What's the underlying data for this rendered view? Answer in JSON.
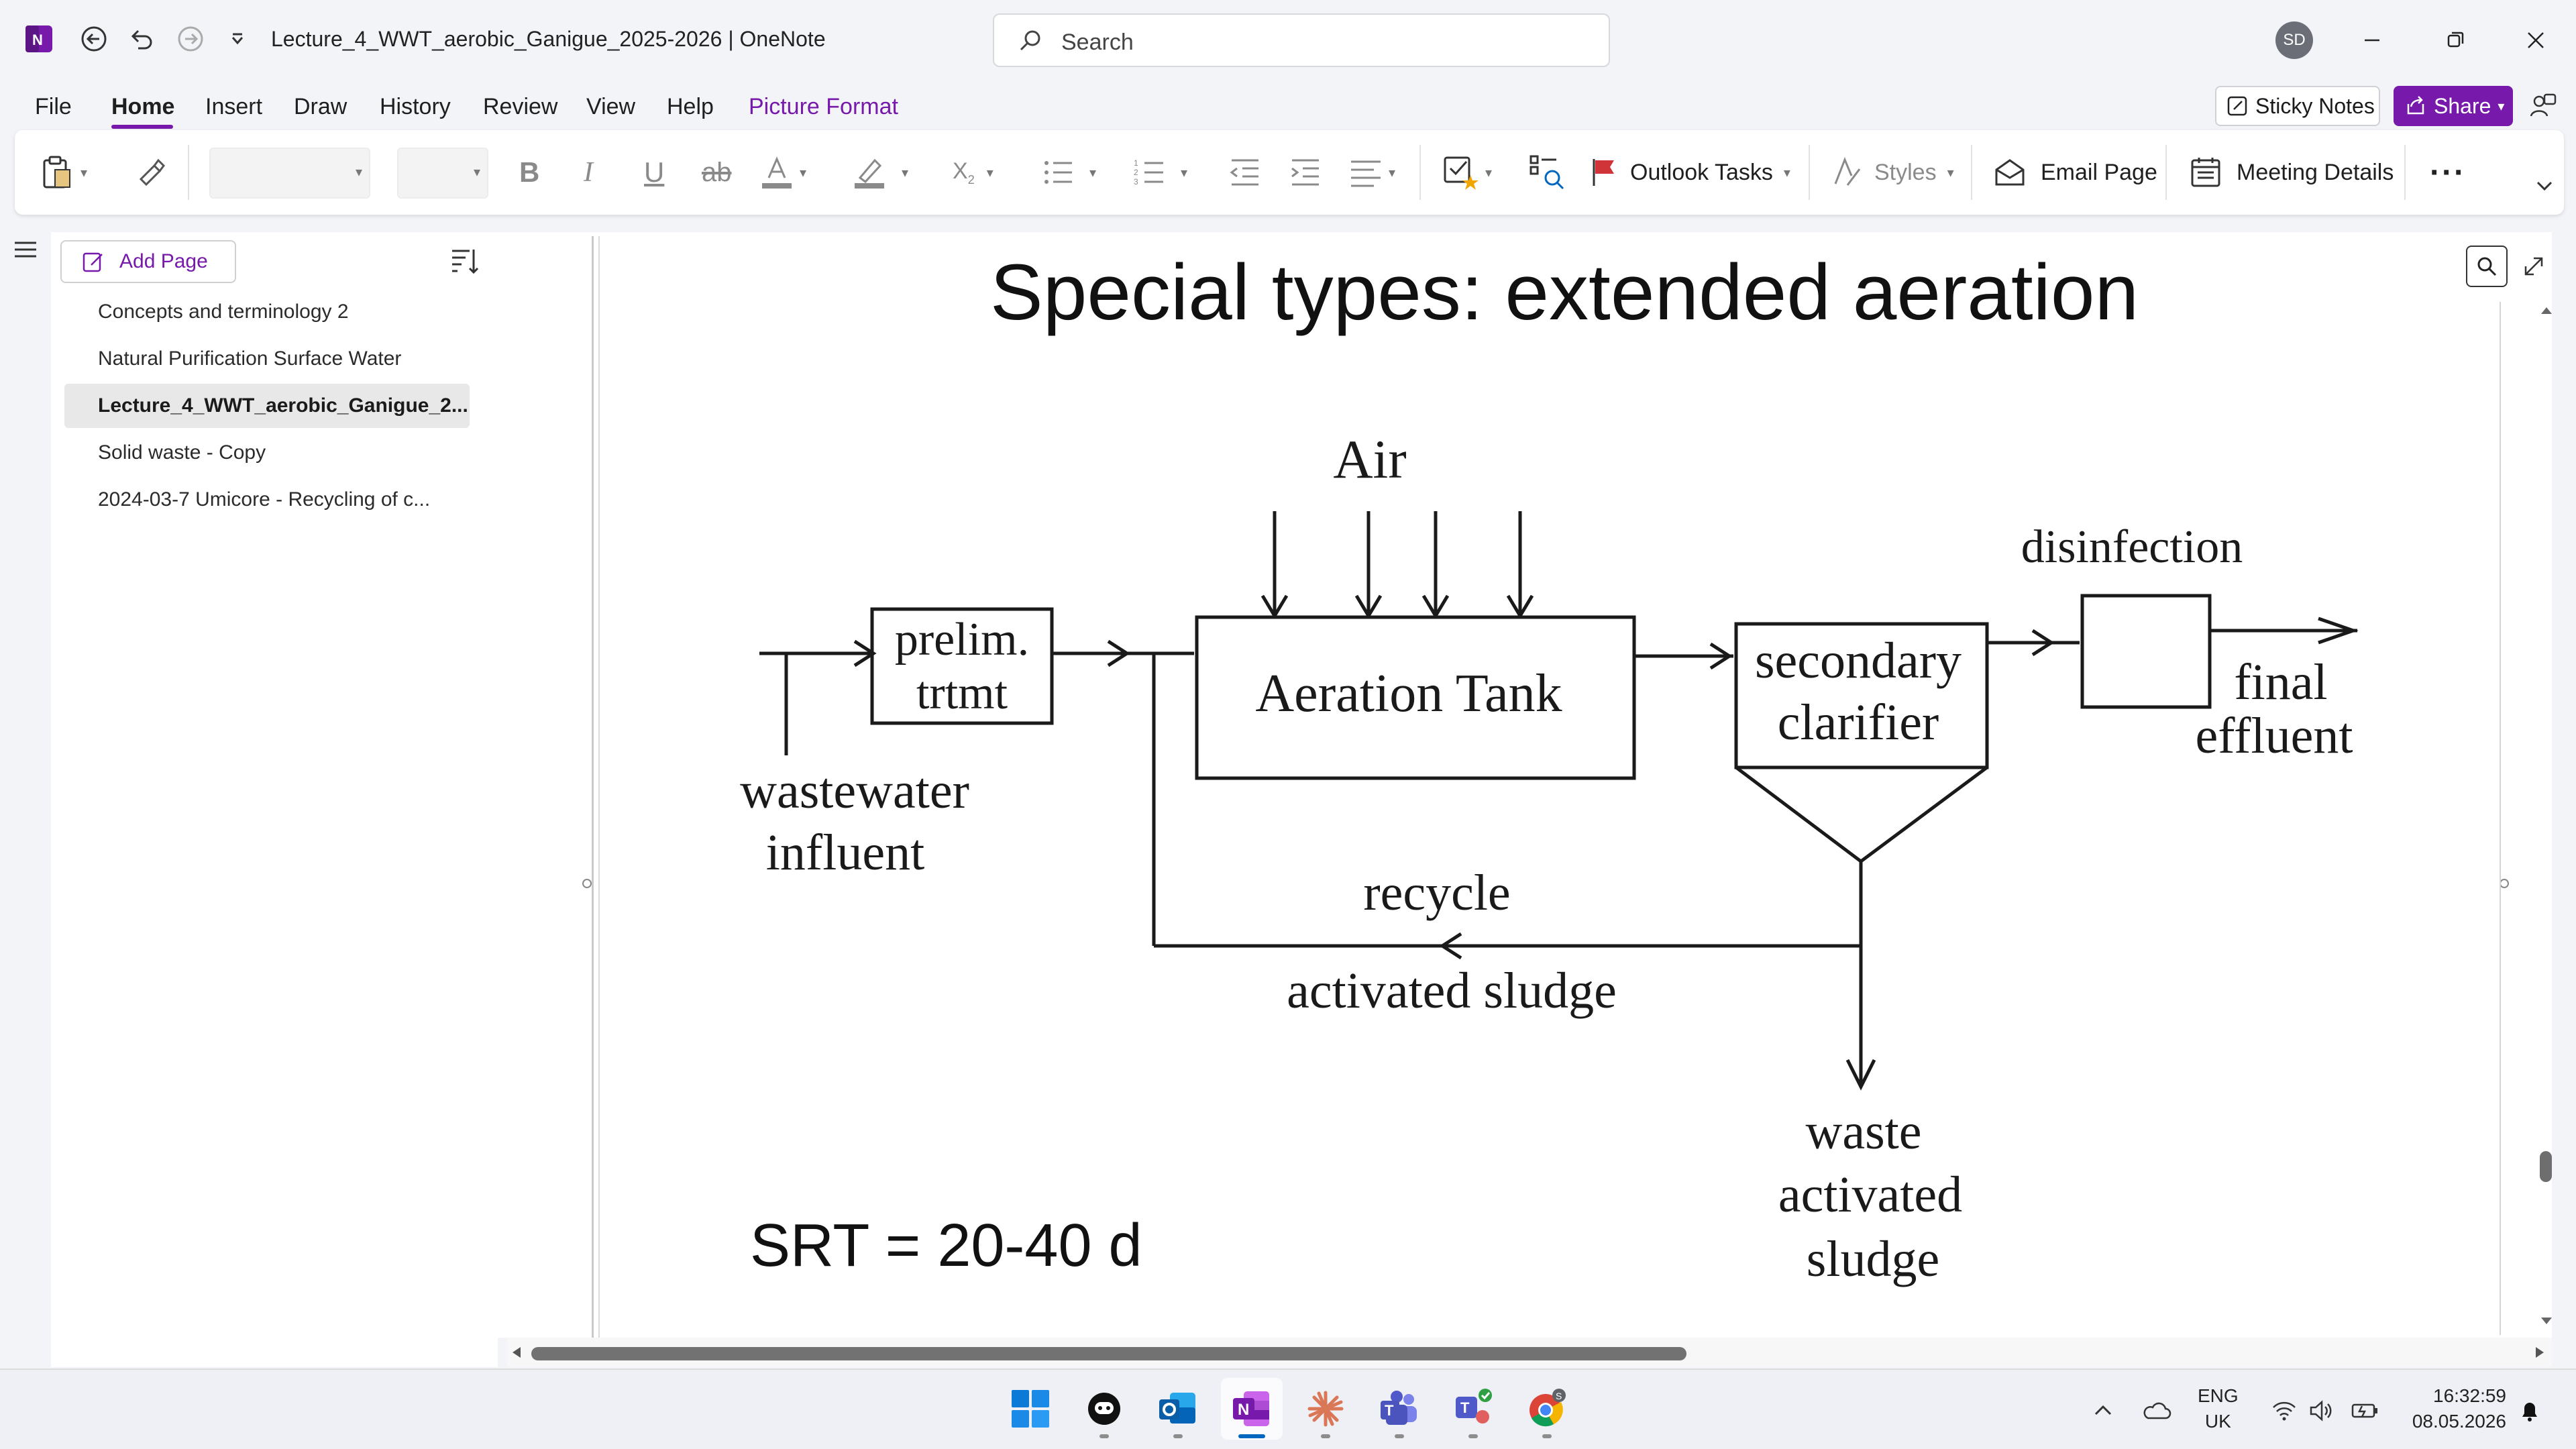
{
  "window": {
    "title": "Lecture_4_WWT_aerobic_Ganigue_2025-2026  |  OneNote",
    "search_placeholder": "Search",
    "avatar_initials": "SD"
  },
  "menu": {
    "file": "File",
    "home": "Home",
    "insert": "Insert",
    "draw": "Draw",
    "history": "History",
    "review": "Review",
    "view": "View",
    "help": "Help",
    "picture_format": "Picture Format",
    "sticky_notes": "Sticky Notes",
    "share": "Share"
  },
  "ribbon": {
    "outlook_tasks": "Outlook Tasks",
    "styles": "Styles",
    "email_page": "Email Page",
    "meeting_details": "Meeting Details",
    "more": "···"
  },
  "pages": {
    "add_page": "Add Page",
    "items": [
      {
        "label": "Concepts and terminology 2"
      },
      {
        "label": "Natural Purification Surface Water"
      },
      {
        "label": "Lecture_4_WWT_aerobic_Ganigue_2..."
      },
      {
        "label": "Solid waste - Copy"
      },
      {
        "label": "2024-03-7 Umicore - Recycling of c..."
      }
    ],
    "active_index": 2
  },
  "slide": {
    "title": "Special types: extended aeration",
    "diagram": {
      "air": "Air",
      "prelim_line1": "prelim.",
      "prelim_line2": "trtmt",
      "aeration_tank": "Aeration Tank",
      "secondary_line1": "secondary",
      "secondary_line2": "clarifier",
      "disinfection": "disinfection",
      "final_line1": "final",
      "final_line2": "effluent",
      "influent_line1": "wastewater",
      "influent_line2": "influent",
      "recycle": "recycle",
      "activated_sludge": "activated sludge",
      "waste_line1": "waste",
      "waste_line2": "activated",
      "waste_line3": "sludge"
    },
    "srt": "SRT = 20-40 d"
  },
  "tray": {
    "lang_line1": "ENG",
    "lang_line2": "UK",
    "time": "16:32:59",
    "date": "08.05.2026"
  },
  "colors": {
    "accent": "#7719aa",
    "taskbar_active": "#0067c0"
  },
  "icons": {
    "taskbar": [
      "windows-start-icon",
      "copilot-icon",
      "outlook-icon",
      "onenote-icon",
      "claude-icon",
      "teams-icon",
      "teams-classic-icon",
      "chrome-icon"
    ]
  }
}
